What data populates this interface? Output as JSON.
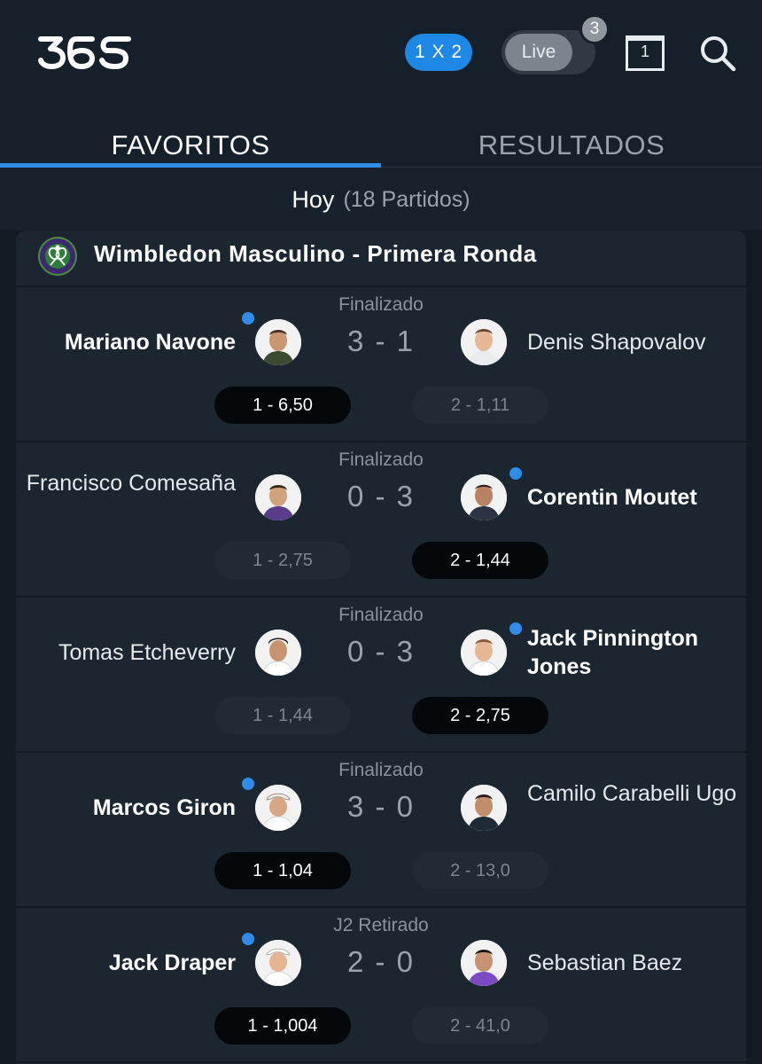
{
  "header": {
    "logo": "365",
    "odds_format": "1 X 2",
    "live_label": "Live",
    "live_count": "3",
    "calendar_day": "1",
    "icons": [
      "calendar-icon",
      "search-icon"
    ]
  },
  "tabs": [
    {
      "label": "FAVORITOS",
      "active": true
    },
    {
      "label": "RESULTADOS",
      "active": false
    }
  ],
  "date_bar": {
    "label": "Hoy",
    "count": "(18 Partidos)"
  },
  "competition": {
    "name": "Wimbledon Masculino - Primera Ronda",
    "logo_text": "THE CHAMPIONSHIPS WIMBLEDON"
  },
  "matches": [
    {
      "status": "Finalizado",
      "home": "Mariano Navone",
      "away": "Denis Shapovalov",
      "score": "3 - 1",
      "odd_home": "1 - 6,50",
      "odd_away": "2 - 1,11",
      "winner": "home"
    },
    {
      "status": "Finalizado",
      "home": "Francisco Comesaña",
      "away": "Corentin Moutet",
      "score": "0 - 3",
      "odd_home": "1 - 2,75",
      "odd_away": "2 - 1,44",
      "winner": "away"
    },
    {
      "status": "Finalizado",
      "home": "Tomas Etcheverry",
      "away": "Jack Pinnington Jones",
      "score": "0 - 3",
      "odd_home": "1 - 1,44",
      "odd_away": "2 - 2,75",
      "winner": "away"
    },
    {
      "status": "Finalizado",
      "home": "Marcos Giron",
      "away": "Camilo Carabelli Ugo",
      "score": "3 - 0",
      "odd_home": "1 - 1,04",
      "odd_away": "2 - 13,0",
      "winner": "home"
    },
    {
      "status": "J2 Retirado",
      "home": "Jack Draper",
      "away": "Sebastian Baez",
      "score": "2 - 0",
      "odd_home": "1 - 1,004",
      "odd_away": "2 - 41,0",
      "winner": "home"
    }
  ],
  "colors": {
    "accent": "#2f8ce8",
    "background": "#121b24",
    "card": "#1c2631",
    "odds_win": "#05080b"
  }
}
